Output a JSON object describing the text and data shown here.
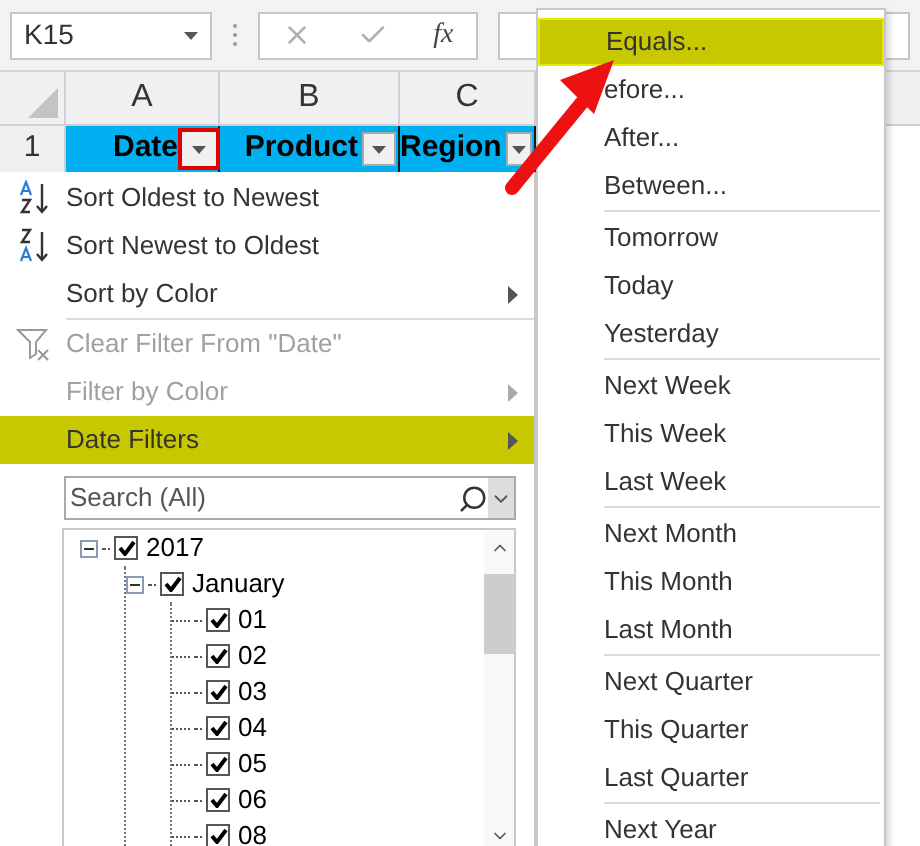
{
  "formula_bar": {
    "name_box": "K15",
    "function_label": "fx"
  },
  "columns": [
    {
      "label": "A"
    },
    {
      "label": "B"
    },
    {
      "label": "C"
    }
  ],
  "header_row": {
    "row_label": "1",
    "cells": [
      {
        "label": "Date",
        "filter_active": true
      },
      {
        "label": "Product",
        "filter_active": false
      },
      {
        "label": "Region",
        "filter_active": false
      }
    ]
  },
  "filter_menu": {
    "groups": [
      [
        {
          "label": "Sort Oldest to Newest",
          "kind": "sort-ascending",
          "submenu": false,
          "disabled": false,
          "selected": false
        },
        {
          "label": "Sort Newest to Oldest",
          "kind": "sort-descending",
          "submenu": false,
          "disabled": false,
          "selected": false
        },
        {
          "label": "Sort by Color",
          "kind": "plain",
          "submenu": true,
          "disabled": false,
          "selected": false
        }
      ],
      [
        {
          "label": "Clear Filter From \"Date\"",
          "kind": "clear-filter",
          "submenu": false,
          "disabled": true,
          "selected": false
        },
        {
          "label": "Filter by Color",
          "kind": "plain",
          "submenu": true,
          "disabled": true,
          "selected": false
        },
        {
          "label": "Date Filters",
          "kind": "plain",
          "submenu": true,
          "disabled": false,
          "selected": true
        }
      ]
    ],
    "search": {
      "placeholder": "Search (All)"
    },
    "tree": [
      {
        "label": "2017",
        "checked": true,
        "expanded": true,
        "children": [
          {
            "label": "January",
            "checked": true,
            "expanded": true,
            "children": [
              {
                "label": "01",
                "checked": true
              },
              {
                "label": "02",
                "checked": true
              },
              {
                "label": "03",
                "checked": true
              },
              {
                "label": "04",
                "checked": true
              },
              {
                "label": "05",
                "checked": true
              },
              {
                "label": "06",
                "checked": true
              },
              {
                "label": "08",
                "checked": true
              }
            ]
          }
        ]
      }
    ]
  },
  "date_filters_menu": {
    "groups": [
      [
        {
          "label": "Equals...",
          "selected": true
        },
        {
          "label": "efore...",
          "selected": false
        },
        {
          "label": "After...",
          "selected": false
        },
        {
          "label": "Between...",
          "selected": false
        }
      ],
      [
        {
          "label": "Tomorrow",
          "selected": false
        },
        {
          "label": "Today",
          "selected": false
        },
        {
          "label": "Yesterday",
          "selected": false
        }
      ],
      [
        {
          "label": "Next Week",
          "selected": false
        },
        {
          "label": "This Week",
          "selected": false
        },
        {
          "label": "Last Week",
          "selected": false
        }
      ],
      [
        {
          "label": "Next Month",
          "selected": false
        },
        {
          "label": "This Month",
          "selected": false
        },
        {
          "label": "Last Month",
          "selected": false
        }
      ],
      [
        {
          "label": "Next Quarter",
          "selected": false
        },
        {
          "label": "This Quarter",
          "selected": false
        },
        {
          "label": "Last Quarter",
          "selected": false
        }
      ],
      [
        {
          "label": "Next Year",
          "selected": false
        }
      ]
    ]
  }
}
